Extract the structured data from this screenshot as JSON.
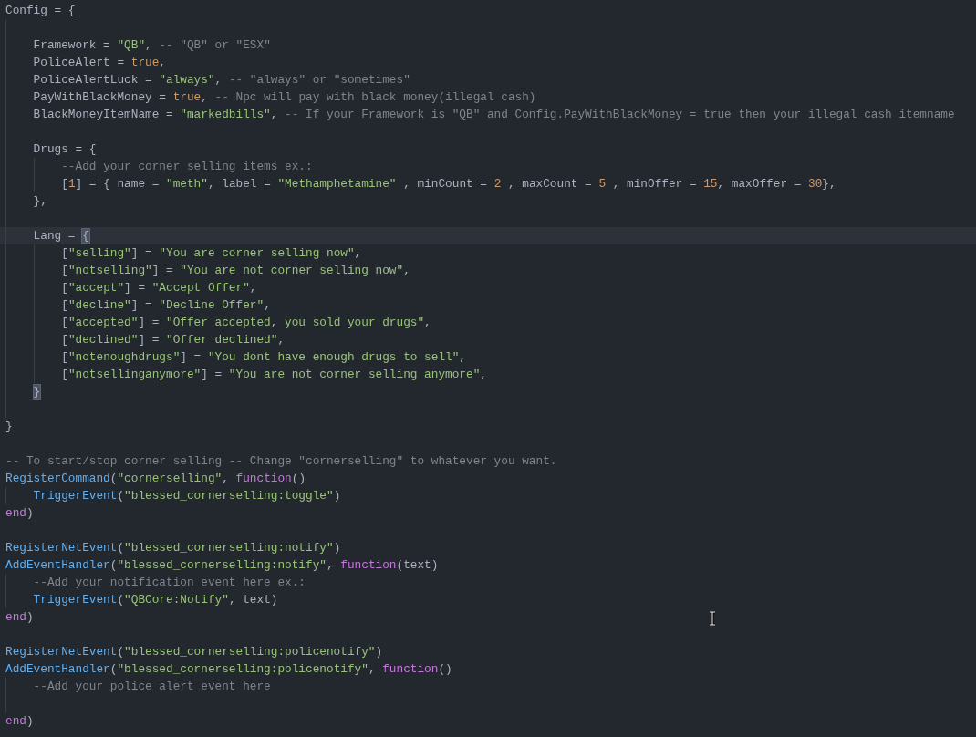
{
  "editor": {
    "lines": [
      {
        "kind": "code",
        "tokens": [
          {
            "kind": "plain",
            "text": "Config = {"
          }
        ]
      },
      {
        "kind": "blank"
      },
      {
        "kind": "code",
        "tokens": [
          {
            "kind": "plain",
            "text": "    Framework = "
          },
          {
            "kind": "string",
            "text": "\"QB\""
          },
          {
            "kind": "plain",
            "text": ", "
          },
          {
            "kind": "comment",
            "text": "-- \"QB\" or \"ESX\""
          }
        ]
      },
      {
        "kind": "code",
        "tokens": [
          {
            "kind": "plain",
            "text": "    PoliceAlert = "
          },
          {
            "kind": "constant",
            "text": "true"
          },
          {
            "kind": "plain",
            "text": ","
          }
        ]
      },
      {
        "kind": "code",
        "tokens": [
          {
            "kind": "plain",
            "text": "    PoliceAlertLuck = "
          },
          {
            "kind": "string",
            "text": "\"always\""
          },
          {
            "kind": "plain",
            "text": ", "
          },
          {
            "kind": "comment",
            "text": "-- \"always\" or \"sometimes\""
          }
        ]
      },
      {
        "kind": "code",
        "tokens": [
          {
            "kind": "plain",
            "text": "    PayWithBlackMoney = "
          },
          {
            "kind": "constant",
            "text": "true"
          },
          {
            "kind": "plain",
            "text": ", "
          },
          {
            "kind": "comment",
            "text": "-- Npc will pay with black money(illegal cash)"
          }
        ]
      },
      {
        "kind": "code",
        "tokens": [
          {
            "kind": "plain",
            "text": "    BlackMoneyItemName = "
          },
          {
            "kind": "string",
            "text": "\"markedbills\""
          },
          {
            "kind": "plain",
            "text": ", "
          },
          {
            "kind": "comment",
            "text": "-- If your Framework is \"QB\" and Config.PayWithBlackMoney = true then your illegal cash itemname"
          }
        ]
      },
      {
        "kind": "blank"
      },
      {
        "kind": "code",
        "tokens": [
          {
            "kind": "plain",
            "text": "    Drugs = {"
          }
        ]
      },
      {
        "kind": "code",
        "tokens": [
          {
            "kind": "comment",
            "text": "        --Add your corner selling items ex.:"
          }
        ]
      },
      {
        "kind": "code",
        "tokens": [
          {
            "kind": "plain",
            "text": "        ["
          },
          {
            "kind": "constant",
            "text": "1"
          },
          {
            "kind": "plain",
            "text": "] = { name = "
          },
          {
            "kind": "string",
            "text": "\"meth\""
          },
          {
            "kind": "plain",
            "text": ", label = "
          },
          {
            "kind": "string",
            "text": "\"Methamphetamine\""
          },
          {
            "kind": "plain",
            "text": " , minCount = "
          },
          {
            "kind": "constant",
            "text": "2"
          },
          {
            "kind": "plain",
            "text": " , maxCount = "
          },
          {
            "kind": "constant",
            "text": "5"
          },
          {
            "kind": "plain",
            "text": " , minOffer = "
          },
          {
            "kind": "constant",
            "text": "15"
          },
          {
            "kind": "plain",
            "text": ", maxOffer = "
          },
          {
            "kind": "constant",
            "text": "30"
          },
          {
            "kind": "plain",
            "text": "},"
          }
        ]
      },
      {
        "kind": "code",
        "tokens": [
          {
            "kind": "plain",
            "text": "    },"
          }
        ]
      },
      {
        "kind": "blank"
      },
      {
        "kind": "code",
        "current": true,
        "tokens": [
          {
            "kind": "plain",
            "text": "    Lang = "
          },
          {
            "kind": "bracket",
            "matched": true,
            "text": "{"
          }
        ]
      },
      {
        "kind": "code",
        "tokens": [
          {
            "kind": "plain",
            "text": "        ["
          },
          {
            "kind": "string",
            "text": "\"selling\""
          },
          {
            "kind": "plain",
            "text": "] = "
          },
          {
            "kind": "string",
            "text": "\"You are corner selling now\""
          },
          {
            "kind": "plain",
            "text": ","
          }
        ]
      },
      {
        "kind": "code",
        "tokens": [
          {
            "kind": "plain",
            "text": "        ["
          },
          {
            "kind": "string",
            "text": "\"notselling\""
          },
          {
            "kind": "plain",
            "text": "] = "
          },
          {
            "kind": "string",
            "text": "\"You are not corner selling now\""
          },
          {
            "kind": "plain",
            "text": ","
          }
        ]
      },
      {
        "kind": "code",
        "tokens": [
          {
            "kind": "plain",
            "text": "        ["
          },
          {
            "kind": "string",
            "text": "\"accept\""
          },
          {
            "kind": "plain",
            "text": "] = "
          },
          {
            "kind": "string",
            "text": "\"Accept Offer\""
          },
          {
            "kind": "plain",
            "text": ","
          }
        ]
      },
      {
        "kind": "code",
        "tokens": [
          {
            "kind": "plain",
            "text": "        ["
          },
          {
            "kind": "string",
            "text": "\"decline\""
          },
          {
            "kind": "plain",
            "text": "] = "
          },
          {
            "kind": "string",
            "text": "\"Decline Offer\""
          },
          {
            "kind": "plain",
            "text": ","
          }
        ]
      },
      {
        "kind": "code",
        "tokens": [
          {
            "kind": "plain",
            "text": "        ["
          },
          {
            "kind": "string",
            "text": "\"accepted\""
          },
          {
            "kind": "plain",
            "text": "] = "
          },
          {
            "kind": "string",
            "text": "\"Offer accepted, you sold your drugs\""
          },
          {
            "kind": "plain",
            "text": ","
          }
        ]
      },
      {
        "kind": "code",
        "tokens": [
          {
            "kind": "plain",
            "text": "        ["
          },
          {
            "kind": "string",
            "text": "\"declined\""
          },
          {
            "kind": "plain",
            "text": "] = "
          },
          {
            "kind": "string",
            "text": "\"Offer declined\""
          },
          {
            "kind": "plain",
            "text": ","
          }
        ]
      },
      {
        "kind": "code",
        "tokens": [
          {
            "kind": "plain",
            "text": "        ["
          },
          {
            "kind": "string",
            "text": "\"notenoughdrugs\""
          },
          {
            "kind": "plain",
            "text": "] = "
          },
          {
            "kind": "string",
            "text": "\"You dont have enough drugs to sell\""
          },
          {
            "kind": "plain",
            "text": ","
          }
        ]
      },
      {
        "kind": "code",
        "tokens": [
          {
            "kind": "plain",
            "text": "        ["
          },
          {
            "kind": "string",
            "text": "\"notsellinganymore\""
          },
          {
            "kind": "plain",
            "text": "] = "
          },
          {
            "kind": "string",
            "text": "\"You are not corner selling anymore\""
          },
          {
            "kind": "plain",
            "text": ","
          }
        ]
      },
      {
        "kind": "code",
        "tokens": [
          {
            "kind": "bracket",
            "matched": true,
            "text": "    }"
          }
        ]
      },
      {
        "kind": "blank"
      },
      {
        "kind": "code",
        "tokens": [
          {
            "kind": "plain",
            "text": "}"
          }
        ]
      },
      {
        "kind": "blank"
      },
      {
        "kind": "code",
        "tokens": [
          {
            "kind": "comment",
            "text": "-- To start/stop corner selling -- Change \"cornerselling\" to whatever you want."
          }
        ]
      },
      {
        "kind": "code",
        "tokens": [
          {
            "kind": "function",
            "text": "RegisterCommand"
          },
          {
            "kind": "plain",
            "text": "("
          },
          {
            "kind": "string",
            "text": "\"cornerselling\""
          },
          {
            "kind": "plain",
            "text": ", "
          },
          {
            "kind": "keyword",
            "text": "function"
          },
          {
            "kind": "plain",
            "text": "()"
          }
        ]
      },
      {
        "kind": "code",
        "tokens": [
          {
            "kind": "function",
            "text": "    TriggerEvent"
          },
          {
            "kind": "plain",
            "text": "("
          },
          {
            "kind": "string",
            "text": "\"blessed_cornerselling:toggle\""
          },
          {
            "kind": "plain",
            "text": ")"
          }
        ]
      },
      {
        "kind": "code",
        "tokens": [
          {
            "kind": "keyword",
            "text": "end"
          },
          {
            "kind": "plain",
            "text": ")"
          }
        ]
      },
      {
        "kind": "blank"
      },
      {
        "kind": "code",
        "tokens": [
          {
            "kind": "function",
            "text": "RegisterNetEvent"
          },
          {
            "kind": "plain",
            "text": "("
          },
          {
            "kind": "string",
            "text": "\"blessed_cornerselling:notify\""
          },
          {
            "kind": "plain",
            "text": ")"
          }
        ]
      },
      {
        "kind": "code",
        "tokens": [
          {
            "kind": "function",
            "text": "AddEventHandler"
          },
          {
            "kind": "plain",
            "text": "("
          },
          {
            "kind": "string",
            "text": "\"blessed_cornerselling:notify\""
          },
          {
            "kind": "plain",
            "text": ", "
          },
          {
            "kind": "keyword",
            "text": "function"
          },
          {
            "kind": "plain",
            "text": "(text)"
          }
        ]
      },
      {
        "kind": "code",
        "tokens": [
          {
            "kind": "comment",
            "text": "    --Add your notification event here ex.:"
          }
        ]
      },
      {
        "kind": "code",
        "tokens": [
          {
            "kind": "function",
            "text": "    TriggerEvent"
          },
          {
            "kind": "plain",
            "text": "("
          },
          {
            "kind": "string",
            "text": "\"QBCore:Notify\""
          },
          {
            "kind": "plain",
            "text": ", text)"
          }
        ]
      },
      {
        "kind": "code",
        "tokens": [
          {
            "kind": "keyword",
            "text": "end"
          },
          {
            "kind": "plain",
            "text": ")"
          }
        ]
      },
      {
        "kind": "blank"
      },
      {
        "kind": "code",
        "tokens": [
          {
            "kind": "function",
            "text": "RegisterNetEvent"
          },
          {
            "kind": "plain",
            "text": "("
          },
          {
            "kind": "string",
            "text": "\"blessed_cornerselling:policenotify\""
          },
          {
            "kind": "plain",
            "text": ")"
          }
        ]
      },
      {
        "kind": "code",
        "tokens": [
          {
            "kind": "function",
            "text": "AddEventHandler"
          },
          {
            "kind": "plain",
            "text": "("
          },
          {
            "kind": "string",
            "text": "\"blessed_cornerselling:policenotify\""
          },
          {
            "kind": "plain",
            "text": ", "
          },
          {
            "kind": "keyword",
            "text": "function"
          },
          {
            "kind": "plain",
            "text": "()"
          }
        ]
      },
      {
        "kind": "code",
        "tokens": [
          {
            "kind": "comment",
            "text": "    --Add your police alert event here"
          }
        ]
      },
      {
        "kind": "blank"
      },
      {
        "kind": "code",
        "tokens": [
          {
            "kind": "keyword",
            "text": "end"
          },
          {
            "kind": "plain",
            "text": ")"
          }
        ]
      }
    ]
  }
}
